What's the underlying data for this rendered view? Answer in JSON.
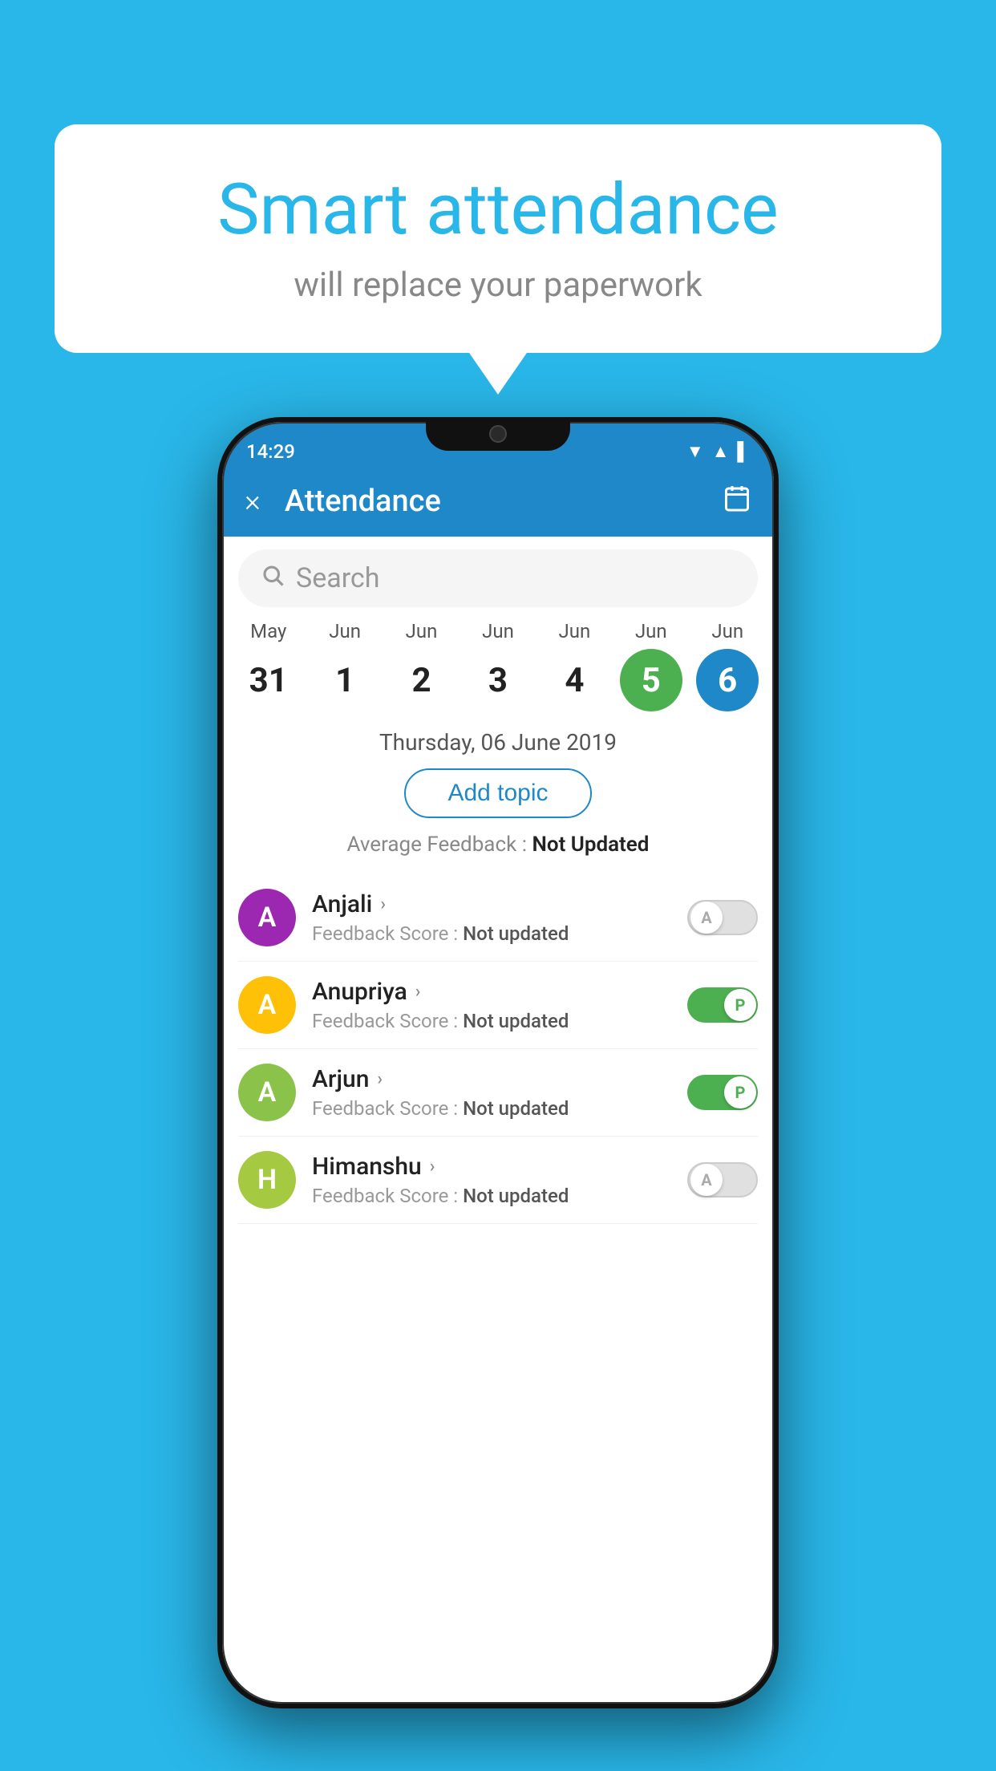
{
  "background_color": "#29B6E8",
  "bubble": {
    "title": "Smart attendance",
    "subtitle": "will replace your paperwork"
  },
  "phone": {
    "status_bar": {
      "time": "14:29"
    },
    "app_bar": {
      "title": "Attendance",
      "close_label": "×",
      "calendar_icon": "📅"
    },
    "search": {
      "placeholder": "Search"
    },
    "calendar": {
      "days": [
        {
          "month": "May",
          "date": "31",
          "state": "normal"
        },
        {
          "month": "Jun",
          "date": "1",
          "state": "normal"
        },
        {
          "month": "Jun",
          "date": "2",
          "state": "normal"
        },
        {
          "month": "Jun",
          "date": "3",
          "state": "normal"
        },
        {
          "month": "Jun",
          "date": "4",
          "state": "normal"
        },
        {
          "month": "Jun",
          "date": "5",
          "state": "today"
        },
        {
          "month": "Jun",
          "date": "6",
          "state": "selected"
        }
      ],
      "selected_date_label": "Thursday, 06 June 2019"
    },
    "add_topic_label": "Add topic",
    "average_feedback": {
      "label": "Average Feedback :",
      "value": "Not Updated"
    },
    "students": [
      {
        "name": "Anjali",
        "avatar_letter": "A",
        "avatar_color": "#9C27B0",
        "feedback_label": "Feedback Score :",
        "feedback_value": "Not updated",
        "toggle_state": "off",
        "toggle_letter": "A"
      },
      {
        "name": "Anupriya",
        "avatar_letter": "A",
        "avatar_color": "#FFC107",
        "feedback_label": "Feedback Score :",
        "feedback_value": "Not updated",
        "toggle_state": "on",
        "toggle_letter": "P"
      },
      {
        "name": "Arjun",
        "avatar_letter": "A",
        "avatar_color": "#8BC34A",
        "feedback_label": "Feedback Score :",
        "feedback_value": "Not updated",
        "toggle_state": "on",
        "toggle_letter": "P"
      },
      {
        "name": "Himanshu",
        "avatar_letter": "H",
        "avatar_color": "#A5C940",
        "feedback_label": "Feedback Score :",
        "feedback_value": "Not updated",
        "toggle_state": "off",
        "toggle_letter": "A"
      }
    ]
  }
}
